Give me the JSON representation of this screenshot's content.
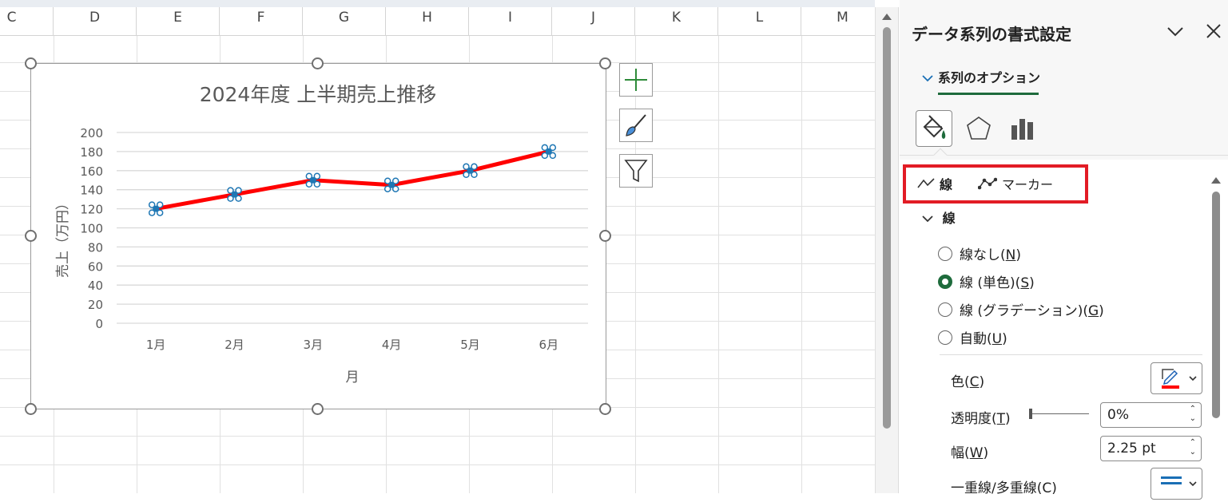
{
  "sheet": {
    "columns": [
      "C",
      "D",
      "E",
      "F",
      "G",
      "H",
      "I",
      "J",
      "K",
      "L",
      "M"
    ]
  },
  "chart": {
    "title": "2024年度 上半期売上推移",
    "xlabel": "月",
    "ylabel": "売上（万円）",
    "line_color": "#ff0000",
    "marker_color": "#1f77b4"
  },
  "chart_data": {
    "type": "line",
    "title": "2024年度 上半期売上推移",
    "categories": [
      "1月",
      "2月",
      "3月",
      "4月",
      "5月",
      "6月"
    ],
    "values": [
      120,
      135,
      150,
      145,
      160,
      180
    ],
    "xlabel": "月",
    "ylabel": "売上（万円）",
    "ylim": [
      0,
      200
    ],
    "yticks": [
      0,
      20,
      40,
      60,
      80,
      100,
      120,
      140,
      160,
      180,
      200
    ],
    "grid": true,
    "legend": "none"
  },
  "chart_buttons": [
    {
      "name": "chart-elements-button",
      "icon": "plus-icon"
    },
    {
      "name": "chart-styles-button",
      "icon": "brush-icon"
    },
    {
      "name": "chart-filters-button",
      "icon": "filter-icon"
    }
  ],
  "pane": {
    "title": "データ系列の書式設定",
    "section": "系列のオプション",
    "tabs": [
      "線",
      "マーカー"
    ],
    "line_section": "線",
    "radios": [
      {
        "label": "線なし(",
        "key": "N",
        "selected": false
      },
      {
        "label": "線 (単色)(",
        "key": "S",
        "selected": true
      },
      {
        "label": "線 (グラデーション)(",
        "key": "G",
        "selected": false
      },
      {
        "label": "自動(",
        "key": "U",
        "selected": false
      }
    ],
    "color_label": "色(",
    "color_key": "C",
    "transparency_label": "透明度(",
    "transparency_key": "T",
    "transparency_value": "0%",
    "width_label": "幅(",
    "width_key": "W",
    "width_value": "2.25 pt",
    "compound_label": "一重線/多重線(C)",
    "accent": "#1e6b3c",
    "line_color": "#ff0000"
  }
}
